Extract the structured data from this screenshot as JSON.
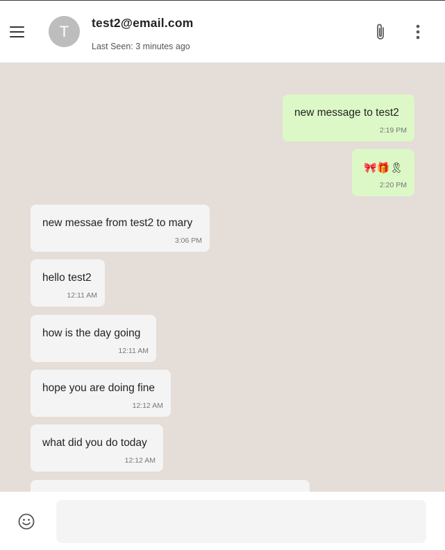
{
  "header": {
    "menu_icon": "hamburger-menu-icon",
    "avatar_initial": "T",
    "contact_email": "test2@email.com",
    "last_seen": "Last Seen: 3 minutes ago",
    "attach_icon": "paperclip-icon",
    "more_icon": "more-vertical-icon"
  },
  "messages": [
    {
      "direction": "sent",
      "text": "new message to test2",
      "time": "2:19 PM"
    },
    {
      "direction": "sent",
      "text": "🎀🎁🎗",
      "time": "2:20 PM"
    },
    {
      "direction": "received",
      "text": "new messae from test2 to mary",
      "time": "3:06 PM"
    },
    {
      "direction": "received",
      "text": "hello test2",
      "time": "12:11 AM"
    },
    {
      "direction": "received",
      "text": "how is the day going",
      "time": "12:11 AM"
    },
    {
      "direction": "received",
      "text": "hope you are doing fine",
      "time": "12:12 AM"
    },
    {
      "direction": "received",
      "text": "what did you do today",
      "time": "12:12 AM"
    }
  ],
  "composer": {
    "emoji_icon": "smiley-face-icon",
    "placeholder": "",
    "value": ""
  },
  "colors": {
    "chat_background": "#e5ddd8",
    "sent_bubble": "#dcf8c6",
    "received_bubble": "#f4f4f4",
    "avatar": "#bdbdbd"
  }
}
